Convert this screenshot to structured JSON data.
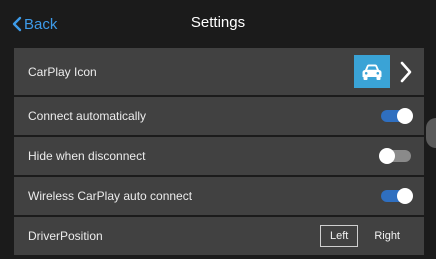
{
  "header": {
    "back_label": "Back",
    "title": "Settings"
  },
  "settings": {
    "carplay_icon": {
      "label": "CarPlay Icon",
      "icon": "car-icon",
      "tile_color": "#3aa3d6"
    },
    "connect_automatically": {
      "label": "Connect automatically",
      "enabled": true
    },
    "hide_when_disconnect": {
      "label": "Hide when disconnect",
      "enabled": false
    },
    "wireless_auto_connect": {
      "label": "Wireless CarPlay auto connect",
      "enabled": true
    },
    "driver_position": {
      "label": "DriverPosition",
      "options": [
        "Left",
        "Right"
      ],
      "selected": "Left"
    }
  },
  "colors": {
    "accent": "#3d9be9",
    "toggle_on": "#2f6fc0",
    "row_bg": "#414141",
    "background": "#1b1b1b"
  }
}
